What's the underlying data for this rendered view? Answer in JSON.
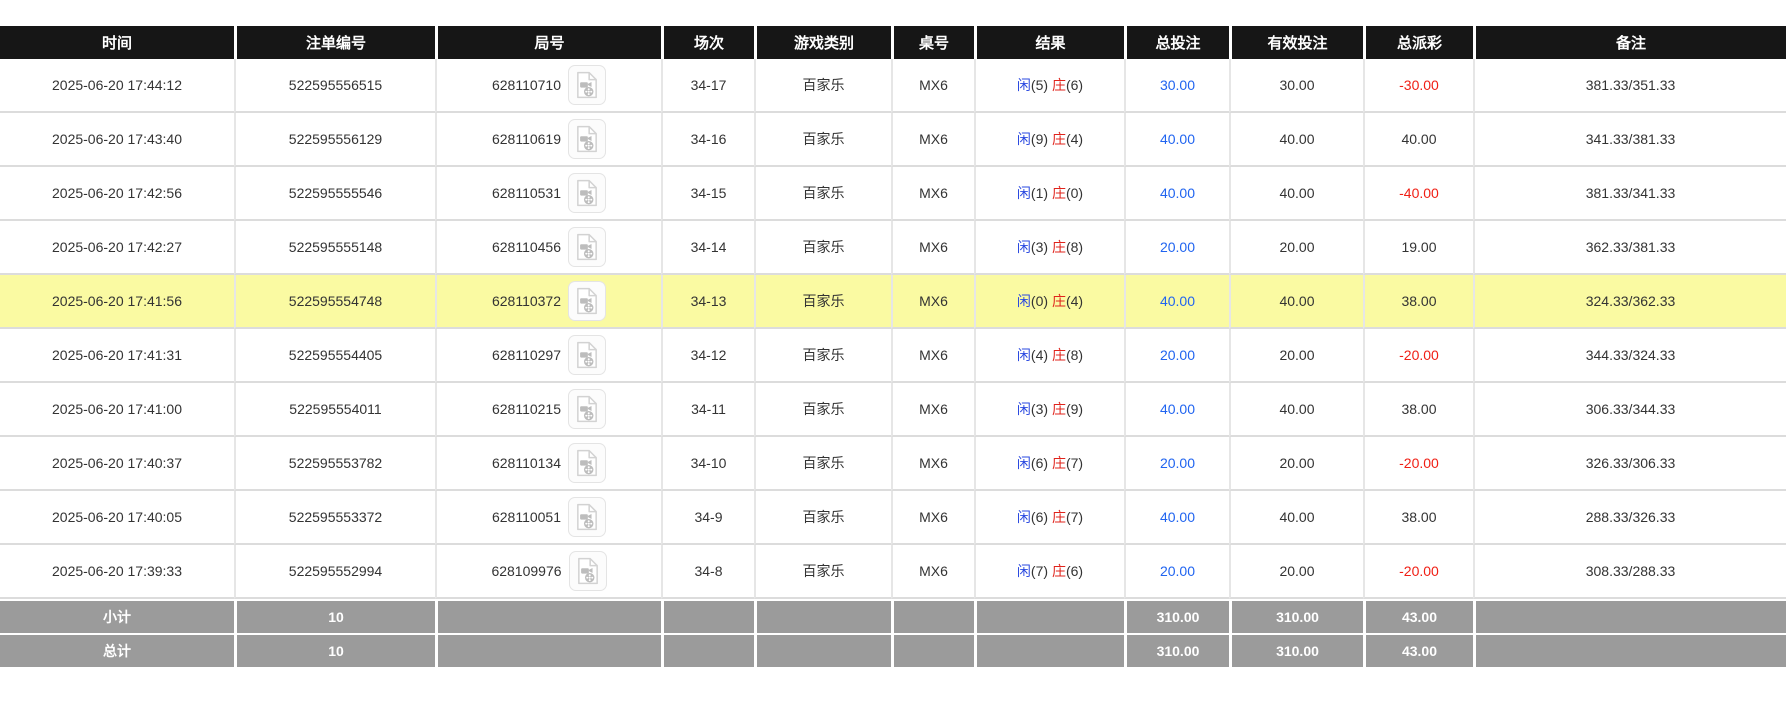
{
  "colors": {
    "header_bg": "#161616",
    "highlight_row": "#fafaa2",
    "summary_bg": "#9b9b9b",
    "player_blue": "#2a49e0",
    "banker_red": "#e0241c",
    "bet_amount_blue": "#2064f0",
    "negative_red": "#f01e14"
  },
  "icons": {
    "round_replay": "video-file-icon"
  },
  "table": {
    "columns": [
      {
        "key": "time",
        "label": "时间"
      },
      {
        "key": "bet_id",
        "label": "注单编号"
      },
      {
        "key": "round_id",
        "label": "局号"
      },
      {
        "key": "session",
        "label": "场次"
      },
      {
        "key": "game_type",
        "label": "游戏类别"
      },
      {
        "key": "table_no",
        "label": "桌号"
      },
      {
        "key": "result",
        "label": "结果"
      },
      {
        "key": "total_bet",
        "label": "总投注"
      },
      {
        "key": "valid_bet",
        "label": "有效投注"
      },
      {
        "key": "payout",
        "label": "总派彩"
      },
      {
        "key": "remark",
        "label": "备注"
      }
    ],
    "rows": [
      {
        "time": "2025-06-20 17:44:12",
        "bet_id": "522595556515",
        "round_id": "628110710",
        "session": "34-17",
        "game_type": "百家乐",
        "table_no": "MX6",
        "result_player_label": "闲",
        "result_player_score": "(5)",
        "result_banker_label": "庄",
        "result_banker_score": "(6)",
        "total_bet": "30.00",
        "valid_bet": "30.00",
        "payout": "-30.00",
        "remark": "381.33/351.33",
        "highlighted": false
      },
      {
        "time": "2025-06-20 17:43:40",
        "bet_id": "522595556129",
        "round_id": "628110619",
        "session": "34-16",
        "game_type": "百家乐",
        "table_no": "MX6",
        "result_player_label": "闲",
        "result_player_score": "(9)",
        "result_banker_label": "庄",
        "result_banker_score": "(4)",
        "total_bet": "40.00",
        "valid_bet": "40.00",
        "payout": "40.00",
        "remark": "341.33/381.33",
        "highlighted": false
      },
      {
        "time": "2025-06-20 17:42:56",
        "bet_id": "522595555546",
        "round_id": "628110531",
        "session": "34-15",
        "game_type": "百家乐",
        "table_no": "MX6",
        "result_player_label": "闲",
        "result_player_score": "(1)",
        "result_banker_label": "庄",
        "result_banker_score": "(0)",
        "total_bet": "40.00",
        "valid_bet": "40.00",
        "payout": "-40.00",
        "remark": "381.33/341.33",
        "highlighted": false
      },
      {
        "time": "2025-06-20 17:42:27",
        "bet_id": "522595555148",
        "round_id": "628110456",
        "session": "34-14",
        "game_type": "百家乐",
        "table_no": "MX6",
        "result_player_label": "闲",
        "result_player_score": "(3)",
        "result_banker_label": "庄",
        "result_banker_score": "(8)",
        "total_bet": "20.00",
        "valid_bet": "20.00",
        "payout": "19.00",
        "remark": "362.33/381.33",
        "highlighted": false
      },
      {
        "time": "2025-06-20 17:41:56",
        "bet_id": "522595554748",
        "round_id": "628110372",
        "session": "34-13",
        "game_type": "百家乐",
        "table_no": "MX6",
        "result_player_label": "闲",
        "result_player_score": "(0)",
        "result_banker_label": "庄",
        "result_banker_score": "(4)",
        "total_bet": "40.00",
        "valid_bet": "40.00",
        "payout": "38.00",
        "remark": "324.33/362.33",
        "highlighted": true
      },
      {
        "time": "2025-06-20 17:41:31",
        "bet_id": "522595554405",
        "round_id": "628110297",
        "session": "34-12",
        "game_type": "百家乐",
        "table_no": "MX6",
        "result_player_label": "闲",
        "result_player_score": "(4)",
        "result_banker_label": "庄",
        "result_banker_score": "(8)",
        "total_bet": "20.00",
        "valid_bet": "20.00",
        "payout": "-20.00",
        "remark": "344.33/324.33",
        "highlighted": false
      },
      {
        "time": "2025-06-20 17:41:00",
        "bet_id": "522595554011",
        "round_id": "628110215",
        "session": "34-11",
        "game_type": "百家乐",
        "table_no": "MX6",
        "result_player_label": "闲",
        "result_player_score": "(3)",
        "result_banker_label": "庄",
        "result_banker_score": "(9)",
        "total_bet": "40.00",
        "valid_bet": "40.00",
        "payout": "38.00",
        "remark": "306.33/344.33",
        "highlighted": false
      },
      {
        "time": "2025-06-20 17:40:37",
        "bet_id": "522595553782",
        "round_id": "628110134",
        "session": "34-10",
        "game_type": "百家乐",
        "table_no": "MX6",
        "result_player_label": "闲",
        "result_player_score": "(6)",
        "result_banker_label": "庄",
        "result_banker_score": "(7)",
        "total_bet": "20.00",
        "valid_bet": "20.00",
        "payout": "-20.00",
        "remark": "326.33/306.33",
        "highlighted": false
      },
      {
        "time": "2025-06-20 17:40:05",
        "bet_id": "522595553372",
        "round_id": "628110051",
        "session": "34-9",
        "game_type": "百家乐",
        "table_no": "MX6",
        "result_player_label": "闲",
        "result_player_score": "(6)",
        "result_banker_label": "庄",
        "result_banker_score": "(7)",
        "total_bet": "40.00",
        "valid_bet": "40.00",
        "payout": "38.00",
        "remark": "288.33/326.33",
        "highlighted": false
      },
      {
        "time": "2025-06-20 17:39:33",
        "bet_id": "522595552994",
        "round_id": "628109976",
        "session": "34-8",
        "game_type": "百家乐",
        "table_no": "MX6",
        "result_player_label": "闲",
        "result_player_score": "(7)",
        "result_banker_label": "庄",
        "result_banker_score": "(6)",
        "total_bet": "20.00",
        "valid_bet": "20.00",
        "payout": "-20.00",
        "remark": "308.33/288.33",
        "highlighted": false
      }
    ],
    "summary_rows": [
      {
        "label": "小计",
        "count": "10",
        "total_bet": "310.00",
        "valid_bet": "310.00",
        "payout": "43.00"
      },
      {
        "label": "总计",
        "count": "10",
        "total_bet": "310.00",
        "valid_bet": "310.00",
        "payout": "43.00"
      }
    ]
  }
}
